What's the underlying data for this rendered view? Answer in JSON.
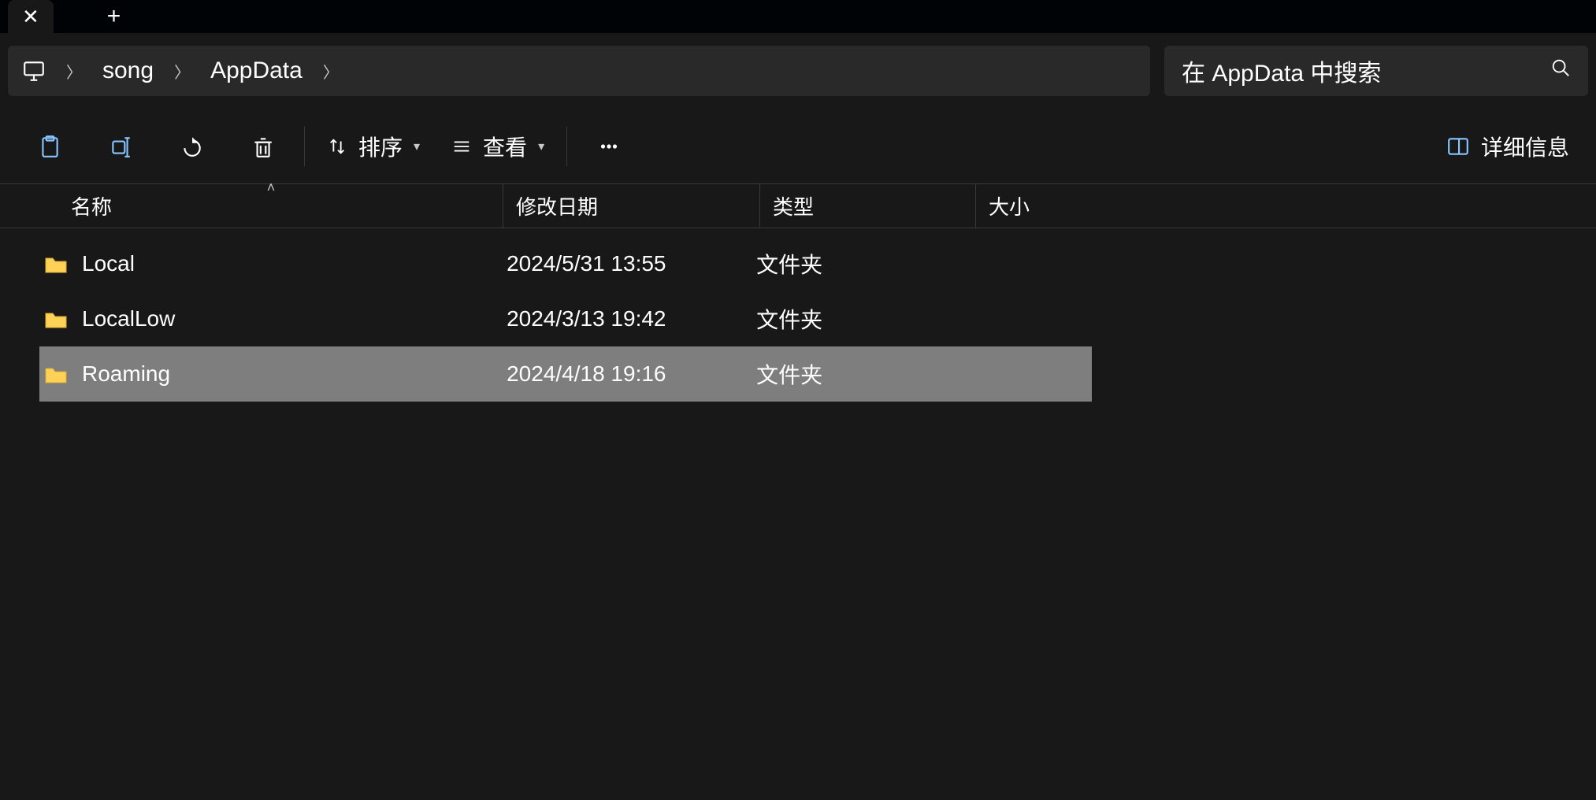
{
  "tabs": {
    "new_tab_tip": "+"
  },
  "breadcrumb": {
    "items": [
      "song",
      "AppData"
    ]
  },
  "search": {
    "placeholder": "在 AppData 中搜索"
  },
  "toolbar": {
    "sort_label": "排序",
    "view_label": "查看",
    "details_label": "详细信息"
  },
  "columns": {
    "name": "名称",
    "date": "修改日期",
    "type": "类型",
    "size": "大小"
  },
  "rows": [
    {
      "name": "Local",
      "date": "2024/5/31 13:55",
      "type": "文件夹",
      "size": "",
      "selected": false
    },
    {
      "name": "LocalLow",
      "date": "2024/3/13 19:42",
      "type": "文件夹",
      "size": "",
      "selected": false
    },
    {
      "name": "Roaming",
      "date": "2024/4/18 19:16",
      "type": "文件夹",
      "size": "",
      "selected": true
    }
  ]
}
